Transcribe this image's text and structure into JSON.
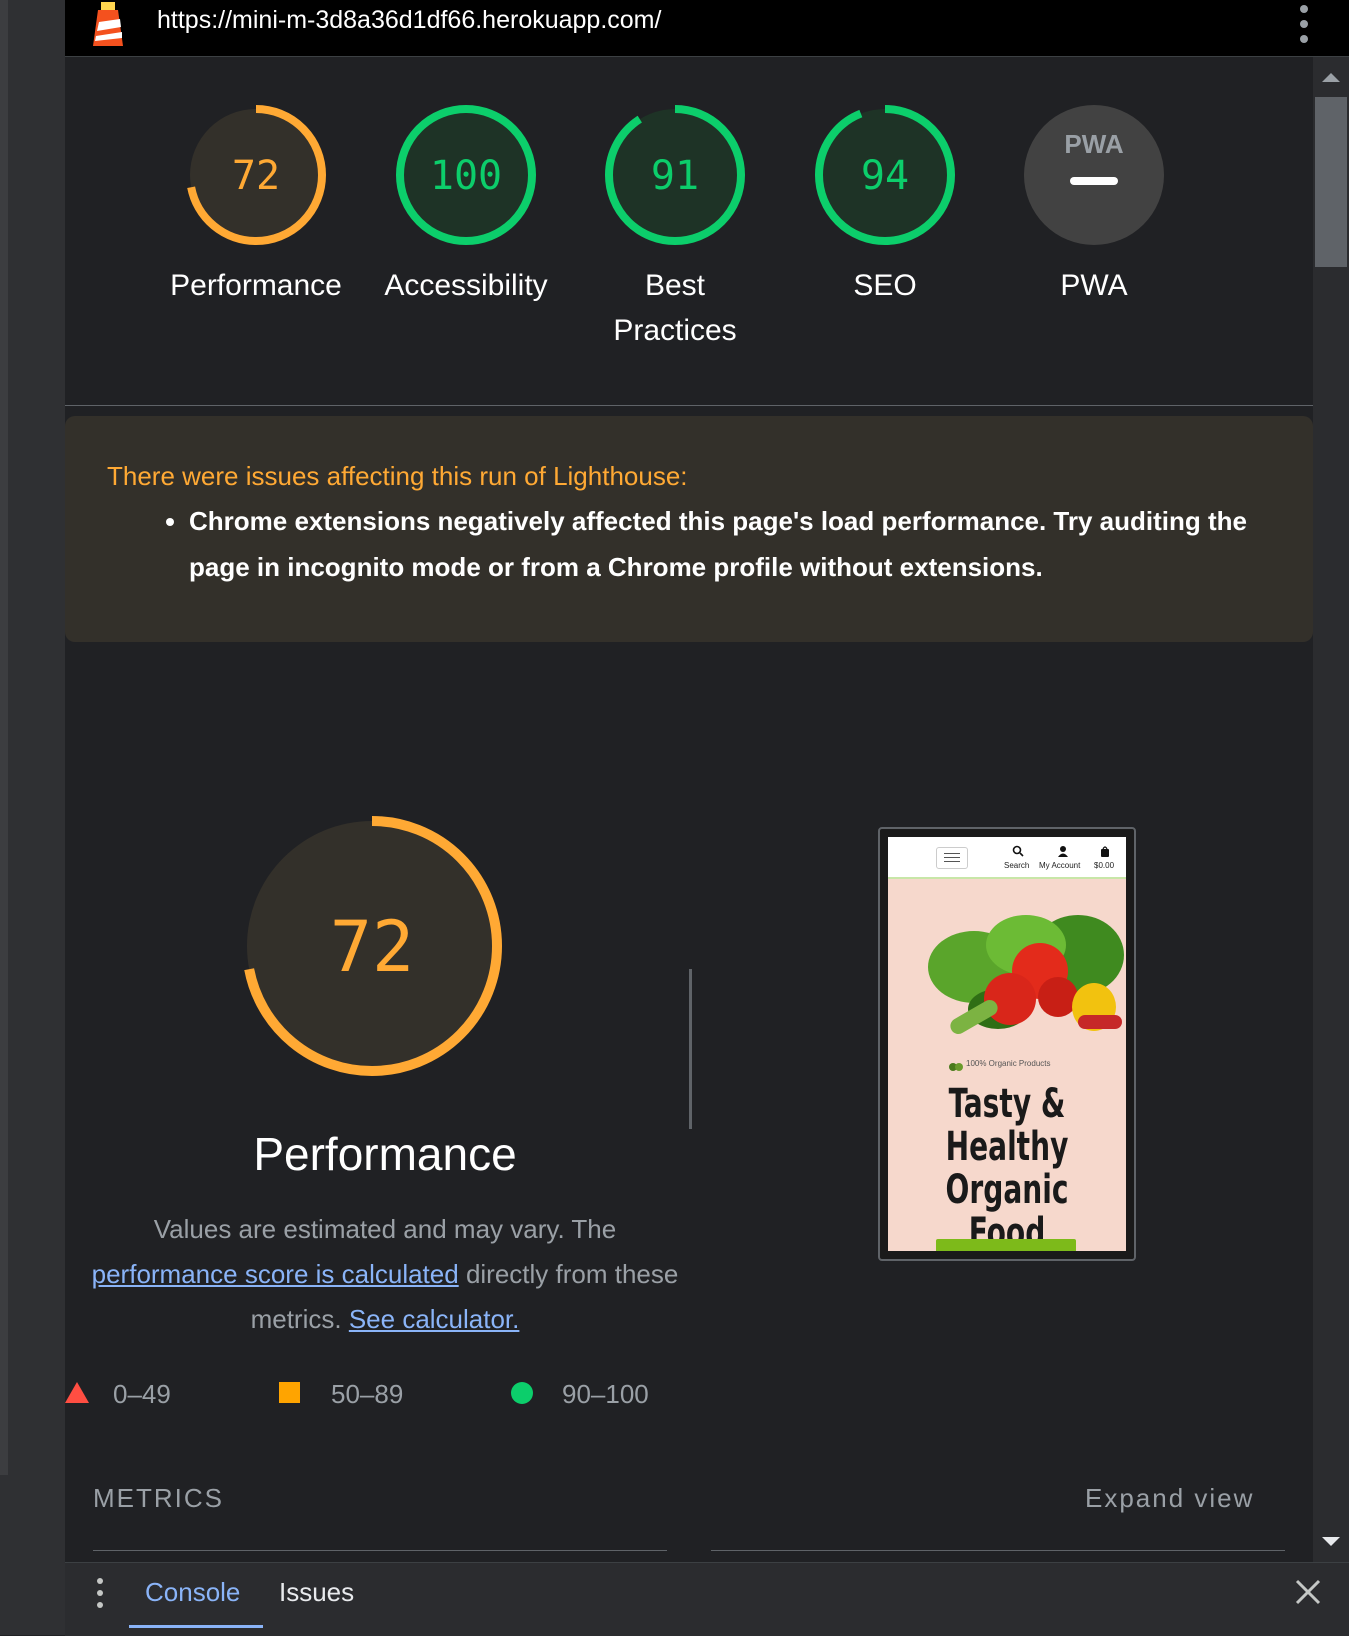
{
  "topbar": {
    "url": "https://mini-m-3d8a36d1df66.herokuapp.com/"
  },
  "gauges": [
    {
      "id": "performance",
      "score": "72",
      "label": "Performance",
      "color": "#ffa934",
      "fill": "#33302a"
    },
    {
      "id": "accessibility",
      "score": "100",
      "label": "Accessibility",
      "color": "#0cce6b",
      "fill": "#1e3326"
    },
    {
      "id": "best-practices",
      "score": "91",
      "label": "Best Practices",
      "color": "#0cce6b",
      "fill": "#1e3326"
    },
    {
      "id": "seo",
      "score": "94",
      "label": "SEO",
      "color": "#0cce6b",
      "fill": "#1e3326"
    },
    {
      "id": "pwa",
      "score": "PWA",
      "label": "PWA",
      "color": "#9aa0a6",
      "fill": "#424242"
    }
  ],
  "issues": {
    "title": "There were issues affecting this run of Lighthouse:",
    "items": [
      "Chrome extensions negatively affected this page's load performance. Try auditing the page in incognito mode or from a Chrome profile without extensions."
    ]
  },
  "performance": {
    "score": "72",
    "title": "Performance",
    "desc_1": "Values are estimated and may vary. The",
    "link_1": "performance score is calculated",
    "desc_2": "directly from these metrics.",
    "link_2": "See calculator."
  },
  "legend": [
    {
      "shape": "triangle",
      "range": "0–49",
      "color": "#ff4e42"
    },
    {
      "shape": "square",
      "range": "50–89",
      "color": "#ffa400"
    },
    {
      "shape": "circle",
      "range": "90–100",
      "color": "#0cce6b"
    }
  ],
  "metrics": {
    "title": "METRICS",
    "expand": "Expand view"
  },
  "screenshot": {
    "nav_search": "Search",
    "nav_account": "My Account",
    "nav_cart": "$0.00",
    "tagline": "100% Organic Products",
    "heading_1": "Tasty &",
    "heading_2": "Healthy",
    "heading_3": "Organic Food"
  },
  "drawer": {
    "tab_console": "Console",
    "tab_issues": "Issues"
  }
}
